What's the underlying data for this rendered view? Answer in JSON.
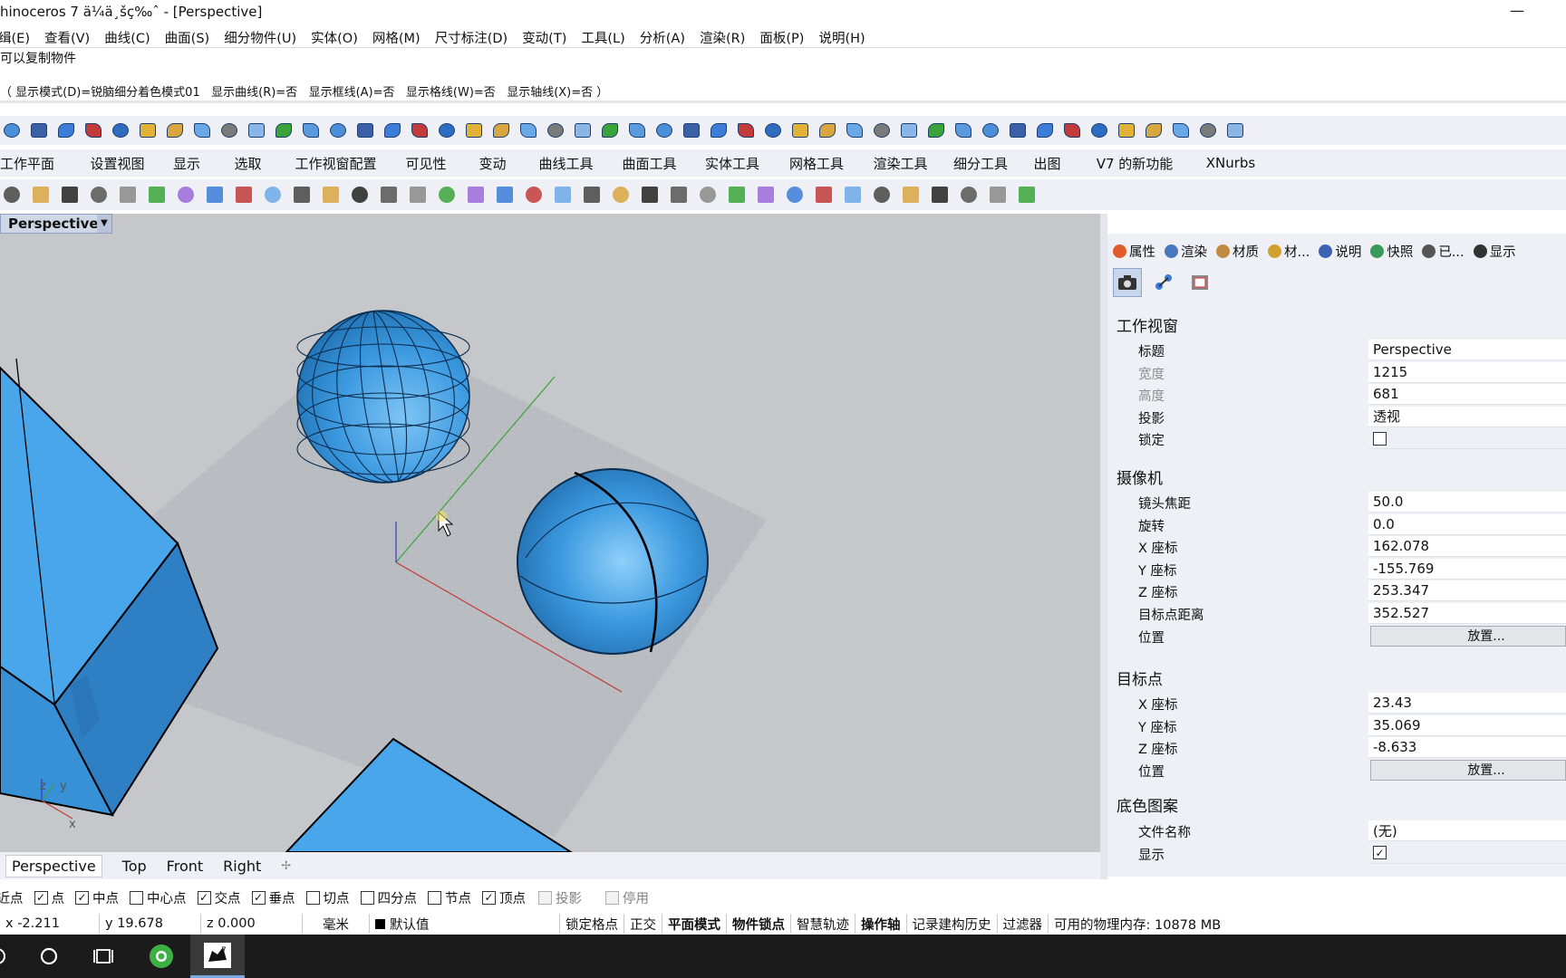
{
  "window": {
    "title": "hinoceros 7 ä¼ä¸šç‰ˆ - [Perspective]",
    "minimize": "—"
  },
  "menu": [
    "缉(E)",
    "查看(V)",
    "曲线(C)",
    "曲面(S)",
    "细分物件(U)",
    "实体(O)",
    "网格(M)",
    "尺寸标注(D)",
    "变动(T)",
    "工具(L)",
    "分析(A)",
    "渲染(R)",
    "面板(P)",
    "说明(H)"
  ],
  "command": {
    "history": "可以复制物件",
    "prompt": "（ 显示模式(D)=锐脑细分着色模式01   显示曲线(R)=否   显示框线(A)=否   显示格线(W)=否   显示轴线(X)=否 ）"
  },
  "tabs": [
    "工作平面",
    "设置视图",
    "显示",
    "选取",
    "工作视窗配置",
    "可见性",
    "变动",
    "曲线工具",
    "曲面工具",
    "实体工具",
    "网格工具",
    "渲染工具",
    "细分工具",
    "出图",
    "V7 的新功能",
    "XNurbs"
  ],
  "viewport": {
    "active_label": "Perspective",
    "dropdown": "▼",
    "axis_labels": {
      "z": "z",
      "y": "y",
      "x": "x"
    },
    "bottom_tabs": [
      "Perspective",
      "Top",
      "Front",
      "Right"
    ],
    "add_tab": "✢"
  },
  "panel": {
    "tabs": [
      {
        "label": "属性",
        "color": "#e05a2a"
      },
      {
        "label": "渲染",
        "color": "#4a78c0"
      },
      {
        "label": "材质",
        "color": "#c08a40"
      },
      {
        "label": "材...",
        "color": "#d0a030"
      },
      {
        "label": "说明",
        "color": "#3b62b5"
      },
      {
        "label": "快照",
        "color": "#3a9a5a"
      },
      {
        "label": "已...",
        "color": "#555555"
      },
      {
        "label": "显示",
        "color": "#333333"
      }
    ],
    "sections": {
      "viewport": "工作视窗",
      "camera": "摄像机",
      "target": "目标点",
      "wallpaper": "底色图案"
    },
    "viewport_rows": [
      {
        "label": "标题",
        "value": "Perspective"
      },
      {
        "label": "宽度",
        "value": "1215"
      },
      {
        "label": "高度",
        "value": "681"
      },
      {
        "label": "投影",
        "value": "透视"
      },
      {
        "label": "锁定",
        "value": ""
      }
    ],
    "camera_rows": [
      {
        "label": "镜头焦距",
        "value": "50.0"
      },
      {
        "label": "旋转",
        "value": "0.0"
      },
      {
        "label": "X 座标",
        "value": "162.078"
      },
      {
        "label": "Y 座标",
        "value": "-155.769"
      },
      {
        "label": "Z 座标",
        "value": "253.347"
      },
      {
        "label": "目标点距离",
        "value": "352.527"
      },
      {
        "label": "位置",
        "value": "放置..."
      }
    ],
    "target_rows": [
      {
        "label": "X 座标",
        "value": "23.43"
      },
      {
        "label": "Y 座标",
        "value": "35.069"
      },
      {
        "label": "Z 座标",
        "value": "-8.633"
      },
      {
        "label": "位置",
        "value": "放置..."
      }
    ],
    "wallpaper_rows": [
      {
        "label": "文件名称",
        "value": "(无)"
      },
      {
        "label": "显示",
        "value": "✓"
      }
    ]
  },
  "osnap": [
    {
      "label": "最近点",
      "checked": true,
      "enabled": true
    },
    {
      "label": "点",
      "checked": true,
      "enabled": true
    },
    {
      "label": "中点",
      "checked": true,
      "enabled": true
    },
    {
      "label": "中心点",
      "checked": false,
      "enabled": true
    },
    {
      "label": "交点",
      "checked": true,
      "enabled": true
    },
    {
      "label": "垂点",
      "checked": true,
      "enabled": true
    },
    {
      "label": "切点",
      "checked": false,
      "enabled": true
    },
    {
      "label": "四分点",
      "checked": false,
      "enabled": true
    },
    {
      "label": "节点",
      "checked": false,
      "enabled": true
    },
    {
      "label": "顶点",
      "checked": true,
      "enabled": true
    },
    {
      "label": "投影",
      "checked": false,
      "enabled": false
    },
    {
      "label": "停用",
      "checked": false,
      "enabled": false
    }
  ],
  "status": {
    "x": "x -2.211",
    "y": "y 19.678",
    "z": "z 0.000",
    "units": "毫米",
    "layer": "默认值",
    "toggles": [
      "锁定格点",
      "正交",
      "平面模式",
      "物件锁点",
      "智慧轨迹",
      "操作轴",
      "记录建构历史",
      "过滤器"
    ],
    "memory": "可用的物理内存: 10878 MB"
  },
  "colors": {
    "object_blue": "#3d9ae0",
    "viewport_bg": "#c5c7ca",
    "grid": "#9ea3a8",
    "panel_bg": "#eef0f5"
  }
}
